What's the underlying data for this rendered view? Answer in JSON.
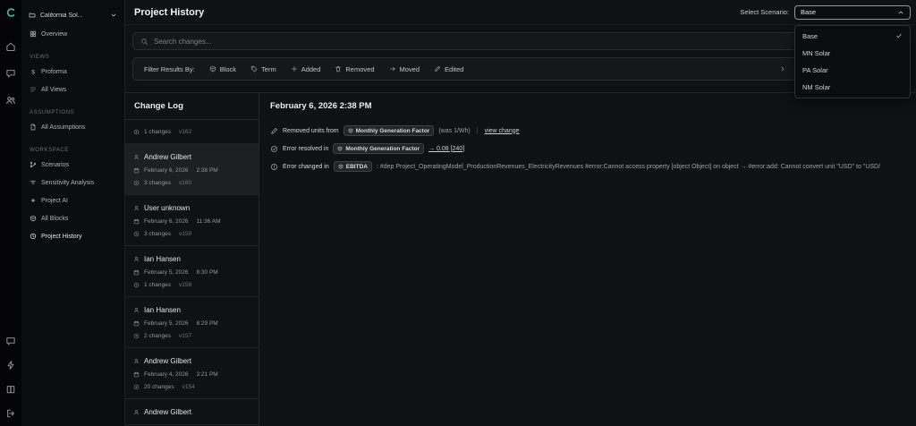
{
  "colors": {
    "logo_accent": "#4db6ac",
    "panel": "#16171a",
    "border": "#2b2c30",
    "selected_entry": "#1d1f23"
  },
  "rail": {
    "top": [
      "logo",
      "home",
      "chat",
      "users"
    ],
    "bottom": [
      "message",
      "bolt",
      "book",
      "logout"
    ]
  },
  "sidebar": {
    "project_label": "California Sol...",
    "overview_label": "Overview",
    "sections": [
      {
        "title": "VIEWS",
        "items": [
          {
            "icon": "dollar",
            "label": "Proforma"
          },
          {
            "icon": "views",
            "label": "All Views"
          }
        ]
      },
      {
        "title": "ASSUMPTIONS",
        "items": [
          {
            "icon": "doc",
            "label": "All Assumptions"
          }
        ]
      },
      {
        "title": "WORKSPACE",
        "items": [
          {
            "icon": "branch",
            "label": "Scenarios"
          },
          {
            "icon": "funnel",
            "label": "Sensitivity Analysis"
          },
          {
            "icon": "spark",
            "label": "Project AI"
          },
          {
            "icon": "blocks",
            "label": "All Blocks"
          },
          {
            "icon": "clock",
            "label": "Project History",
            "active": true
          }
        ]
      }
    ]
  },
  "header": {
    "title": "Project History",
    "scenario_label": "Select Scenario:",
    "scenario_value": "Base"
  },
  "scenario_menu": {
    "options": [
      {
        "label": "Base",
        "selected": true
      },
      {
        "label": "MN Solar",
        "selected": false
      },
      {
        "label": "PA Solar",
        "selected": false
      },
      {
        "label": "NM Solar",
        "selected": false
      }
    ]
  },
  "search": {
    "placeholder": "Search changes..."
  },
  "filters": {
    "label": "Filter Results By:",
    "buttons": [
      {
        "icon": "cube",
        "label": "Block"
      },
      {
        "icon": "tag",
        "label": "Term"
      },
      {
        "icon": "plus",
        "label": "Added"
      },
      {
        "icon": "trash",
        "label": "Removed"
      },
      {
        "icon": "arrowRight",
        "label": "Moved"
      },
      {
        "icon": "pencil",
        "label": "Edited"
      }
    ]
  },
  "change_log": {
    "title": "Change Log",
    "entries": [
      {
        "changes": "1 changes",
        "version": "v162"
      },
      {
        "author": "Andrew Gilbert",
        "date": "February 6, 2026",
        "time": "2:38 PM",
        "changes": "3 changes",
        "version": "v160",
        "selected": true
      },
      {
        "author": "User unknown",
        "date": "February 6, 2026",
        "time": "11:36 AM",
        "changes": "3 changes",
        "version": "v159"
      },
      {
        "author": "Ian Hansen",
        "date": "February 5, 2026",
        "time": "8:30 PM",
        "changes": "1 changes",
        "version": "v158"
      },
      {
        "author": "Ian Hansen",
        "date": "February 5, 2026",
        "time": "8:29 PM",
        "changes": "2 changes",
        "version": "v157"
      },
      {
        "author": "Andrew Gilbert",
        "date": "February 4, 2026",
        "time": "3:21 PM",
        "changes": "20 changes",
        "version": "v154"
      },
      {
        "author": "Andrew Gilbert"
      }
    ]
  },
  "detail": {
    "title": "February 6, 2026 2:38 PM",
    "rows": [
      {
        "icon": "pencil",
        "text_before": "Removed units from",
        "chip": "Monthly Generation Factor",
        "text_after": "(was 1/Wh)",
        "divider": "|",
        "link": "view change"
      },
      {
        "icon": "checkCircle",
        "text_before": "Error resolved in",
        "chip": "Monthly Generation Factor",
        "link": "→ 0.08 [240]"
      },
      {
        "icon": "alertCircle",
        "text_before": "Error changed in",
        "chip": "EBITDA",
        "text_after": ": #dep Project_OperatingModel_ProductionRevenues_ElectricityRevenues #error:Cannot access property [object Object] on object → #error:add: Cannot convert unit \"USD\" to \"USD/"
      }
    ]
  }
}
